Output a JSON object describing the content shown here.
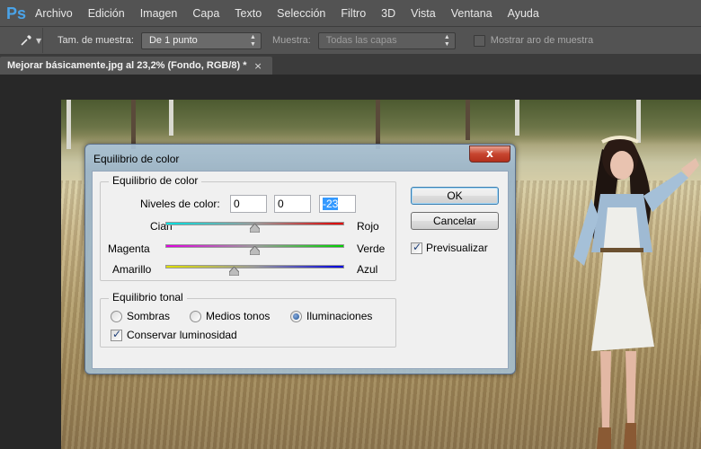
{
  "app": {
    "logo": "Ps"
  },
  "menu": [
    "Archivo",
    "Edición",
    "Imagen",
    "Capa",
    "Texto",
    "Selección",
    "Filtro",
    "3D",
    "Vista",
    "Ventana",
    "Ayuda"
  ],
  "options": {
    "sample_size_label": "Tam. de muestra:",
    "sample_size_value": "De 1 punto",
    "sample_label": "Muestra:",
    "sample_value": "Todas las capas",
    "show_ring_label": "Mostrar aro de muestra"
  },
  "document": {
    "tab_title": "Mejorar básicamente.jpg al 23,2% (Fondo, RGB/8) *",
    "close": "×"
  },
  "dialog": {
    "title": "Equilibrio de color",
    "close": "x",
    "color_balance": {
      "group_title": "Equilibrio de color",
      "levels_label": "Niveles de color:",
      "levels": [
        "0",
        "0",
        "-23"
      ],
      "sliders": [
        {
          "left": "Cian",
          "right": "Rojo",
          "value": 0
        },
        {
          "left": "Magenta",
          "right": "Verde",
          "value": 0
        },
        {
          "left": "Amarillo",
          "right": "Azul",
          "value": -23
        }
      ]
    },
    "tone_balance": {
      "group_title": "Equilibrio tonal",
      "options": [
        "Sombras",
        "Medios tonos",
        "Iluminaciones"
      ],
      "selected": "Iluminaciones",
      "preserve_label": "Conservar luminosidad",
      "preserve_checked": true
    },
    "ok_label": "OK",
    "cancel_label": "Cancelar",
    "preview_label": "Previsualizar",
    "preview_checked": true
  }
}
